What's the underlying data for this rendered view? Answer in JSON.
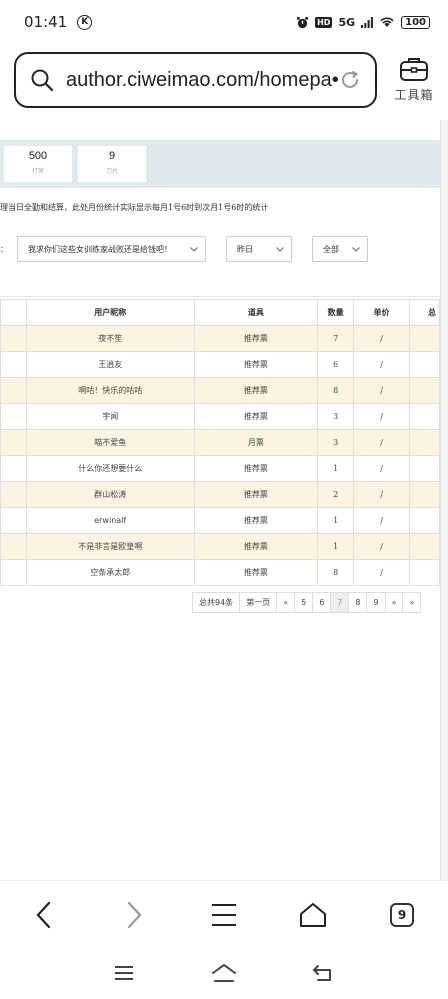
{
  "status_bar": {
    "time": "01:41",
    "k_badge": "K",
    "hd": "HD",
    "network": "5G",
    "battery": "100"
  },
  "browser": {
    "url": "author.ciweimao.com/homepa•••",
    "toolbox_label": "工具箱",
    "tab_count": "9"
  },
  "stats": [
    {
      "value": "500",
      "label": "打赏"
    },
    {
      "value": "9",
      "label": "刀片"
    }
  ],
  "notice": "理当日全勤和结算，此处月份统计实际显示每月1号6时到次月1号6时的统计",
  "filters": {
    "prefix": "：",
    "book": "我求你们这些女训练家战败还是给钱吧！",
    "date": "昨日",
    "type": "全部"
  },
  "table": {
    "columns": [
      "",
      "用户昵称",
      "道具",
      "数量",
      "单价",
      "总"
    ],
    "rows": [
      [
        "",
        "夜不笙",
        "推荐票",
        "7",
        "/",
        ""
      ],
      [
        "",
        "王逍友",
        "推荐票",
        "6",
        "/",
        ""
      ],
      [
        "",
        "啊咕！快乐的咕咕",
        "推荐票",
        "8",
        "/",
        ""
      ],
      [
        "",
        "宇闻",
        "推荐票",
        "3",
        "/",
        ""
      ],
      [
        "",
        "喵不爱鱼",
        "月票",
        "3",
        "/",
        ""
      ],
      [
        "",
        "什么你还想要什么",
        "推荐票",
        "1",
        "/",
        ""
      ],
      [
        "",
        "群山松涛",
        "推荐票",
        "2",
        "/",
        ""
      ],
      [
        "",
        "erwinalf",
        "推荐票",
        "1",
        "/",
        ""
      ],
      [
        "",
        "不是非言是欧皇啊",
        "推荐票",
        "1",
        "/",
        ""
      ],
      [
        "",
        "空条承太郎",
        "推荐票",
        "8",
        "/",
        ""
      ]
    ]
  },
  "pager": {
    "total": "总共94条",
    "first": "第一页",
    "prev": "«",
    "pages": [
      "5",
      "6",
      "7",
      "8",
      "9"
    ],
    "active": "7",
    "next": "»",
    "last": "»"
  }
}
